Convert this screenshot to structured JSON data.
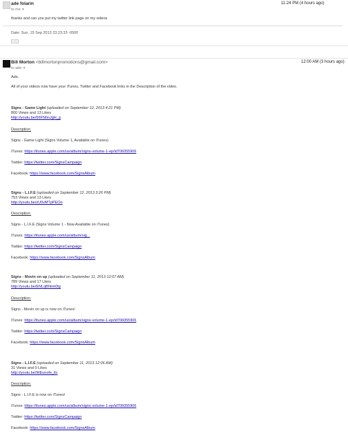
{
  "message1": {
    "sender": "ade folarin",
    "to": "to me",
    "date": "11:24 PM (4 hours ago)",
    "body": "thanks and can you put my twitter link page on my videos",
    "date_line": "Date: Sun, 15 Sep 2013 23:23:33 -0500",
    "show_trimmed": "···"
  },
  "message2": {
    "sender": "Bill Morton",
    "sender_email": "<billmortonpromotions@gmail.com>",
    "to": "to ade",
    "date": "12:00 AM (3 hours ago)",
    "greeting": "Ade,",
    "intro": "All of your videos now have your iTunes, Twitter and Facebook links in the Description of the video.",
    "videos": [
      {
        "title": "Signs - Game Light",
        "uploaded": "(uploaded on September 12, 2013 4:21 PM)",
        "stats": "800 Views and 13 Likes",
        "url": "http://youtu.be/66FNhnJgH_g",
        "desc_label": "Description:",
        "desc_text": "Signs - Game Light (Signs Volume 1, Available on iTunes)",
        "itunes_label": "iTunes:",
        "itunes_url": "https://itunes.apple.com/us/album/signs-volume-1-ep/id706055906",
        "twitter_label": "Twitter:",
        "twitter_url": "https://twitter.com/SignsCampaign",
        "facebook_label": "Facebook:",
        "facebook_url": "https://www.facebook.com/SignsAlbum"
      },
      {
        "title": "Signs - L.I.F.E",
        "uploaded": "(uploaded on September 12, 2013 3:26 PM)",
        "stats": "753 Views and 13 Likes",
        "url": "http://youtu.be/zU0vMTpPEOo",
        "desc_label": "Description:",
        "desc_text": "Signs - L.I.F.E (Signs Volume 1 - Now Available on iTunes)",
        "itunes_label": "iTunes:",
        "itunes_url": "https://itunes.apple.com/us/album/sig...",
        "twitter_label": "Twitter:",
        "twitter_url": "https://twitter.com/SignsCampaign",
        "facebook_label": "Facebook:",
        "facebook_url": "https://www.facebook.com/SignsAlbum"
      },
      {
        "title": "Signs - Movin on up",
        "uploaded": "(uploaded on September 11, 2013 12:07 AM)",
        "stats": "789 Views and 17 Likes",
        "url": "http://youtu.be/ENLqBhkm0tg",
        "desc_label": "Description:",
        "desc_text": "Signs - Movin on up is now on iTunes!",
        "itunes_label": "iTunes:",
        "itunes_url": "https://itunes.apple.com/us/album/signs-volume-1-ep/id706055906",
        "twitter_label": "Twitter:",
        "twitter_url": "https://twitter.com/SignsCampaign",
        "facebook_label": "Facebook:",
        "facebook_url": "https://www.facebook.com/SignsAlbum"
      },
      {
        "title": "Signs - L.I.F.E",
        "uploaded": "(uploaded on September 11, 2013 12:06 AM)",
        "stats": "31 Views and 0 Likes",
        "url": "http://youtu.be/WEunofe_ltc",
        "desc_label": "Description:",
        "desc_text": "Signs - L.I.F.E is now on iTunes!",
        "itunes_label": "iTunes:",
        "itunes_url": "https://itunes.apple.com/us/album/signs-volume-1-ep/id706055906",
        "twitter_label": "Twitter:",
        "twitter_url": "https://twitter.com/SignsCampaign",
        "facebook_label": "Facebook:",
        "facebook_url": "https://www.facebook.com/SignsAlbum"
      }
    ]
  }
}
